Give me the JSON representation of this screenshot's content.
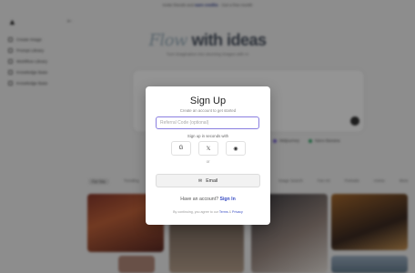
{
  "background": {
    "banner": {
      "prefix": "Invite friends and",
      "highlight": "earn credits",
      "suffix": "· Get a free month"
    },
    "collapse_icon": "collapse-icon",
    "nav": [
      {
        "label": "Create Image",
        "icon": "image-icon"
      },
      {
        "label": "Prompt Library",
        "icon": "library-icon"
      },
      {
        "label": "Workflow Library",
        "icon": "workflow-icon"
      },
      {
        "label": "Knowledge Base",
        "icon": "book-icon"
      },
      {
        "label": "Knowledge Base",
        "icon": "book-icon"
      }
    ],
    "hero": {
      "script": "Flow",
      "text": "with ideas"
    },
    "hero_subtitle": "Turn imagination into stunning images with AI",
    "chips": [
      "Midjourney",
      "Nano Banana"
    ],
    "tabs_left": [
      "For You",
      "Trending"
    ],
    "tabs_right": [
      "Image Search",
      "Fan Art",
      "Portraits",
      "Anime",
      "More"
    ]
  },
  "modal": {
    "title": "Sign Up",
    "subtitle": "Create an account to get started",
    "referral_placeholder": "Referral Code (optional)",
    "signin_text": "Sign up in seconds with",
    "socials": [
      {
        "name": "google",
        "glyph": "G"
      },
      {
        "name": "x",
        "glyph": "𝕏"
      },
      {
        "name": "discord",
        "glyph": "◉"
      }
    ],
    "or_text": "or",
    "email_label": "Email",
    "have_account_text": "Have an account?",
    "signin_link": "Sign In",
    "terms_prefix": "By continuing, you agree to our",
    "terms_link": "Terms",
    "terms_mid": "&",
    "privacy_link": "Privacy"
  },
  "colors": {
    "accent": "#3b4fc4",
    "input_focus": "#8a7fe0",
    "overlay": "rgba(0,0,0,0.42)"
  }
}
